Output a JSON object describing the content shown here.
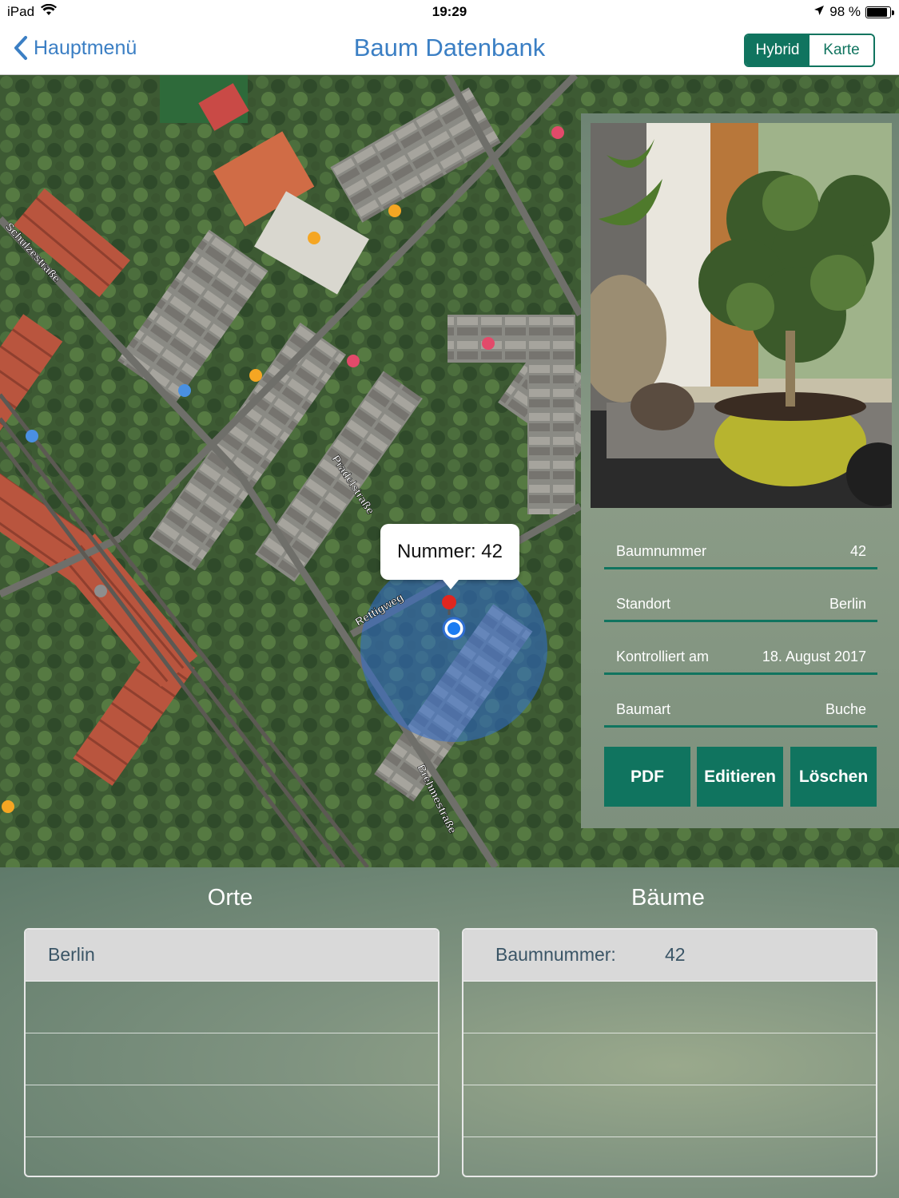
{
  "status": {
    "device": "iPad",
    "time": "19:29",
    "battery": "98 %",
    "battery_level": 0.98
  },
  "nav": {
    "back_label": "Hauptmenü",
    "title": "Baum Datenbank",
    "segments": [
      "Hybrid",
      "Karte"
    ],
    "selected_segment": "Hybrid"
  },
  "map": {
    "streets": [
      "Schulzestraße",
      "Pradelstraße",
      "Rettigweg",
      "Brehmestraße"
    ],
    "callout": "Nummer: 42"
  },
  "detail": {
    "fields": [
      {
        "label": "Baumnummer",
        "value": "42"
      },
      {
        "label": "Standort",
        "value": "Berlin"
      },
      {
        "label": "Kontrolliert am",
        "value": "18. August 2017"
      },
      {
        "label": "Baumart",
        "value": "Buche"
      }
    ],
    "buttons": {
      "pdf": "PDF",
      "edit": "Editieren",
      "delete": "Löschen"
    }
  },
  "places": {
    "title": "Orte",
    "rows": [
      "Berlin"
    ]
  },
  "trees": {
    "title": "Bäume",
    "rows": [
      {
        "label": "Baumnummer:",
        "value": "42"
      }
    ]
  },
  "colors": {
    "accent": "#10745f",
    "link": "#3b7fc4"
  }
}
